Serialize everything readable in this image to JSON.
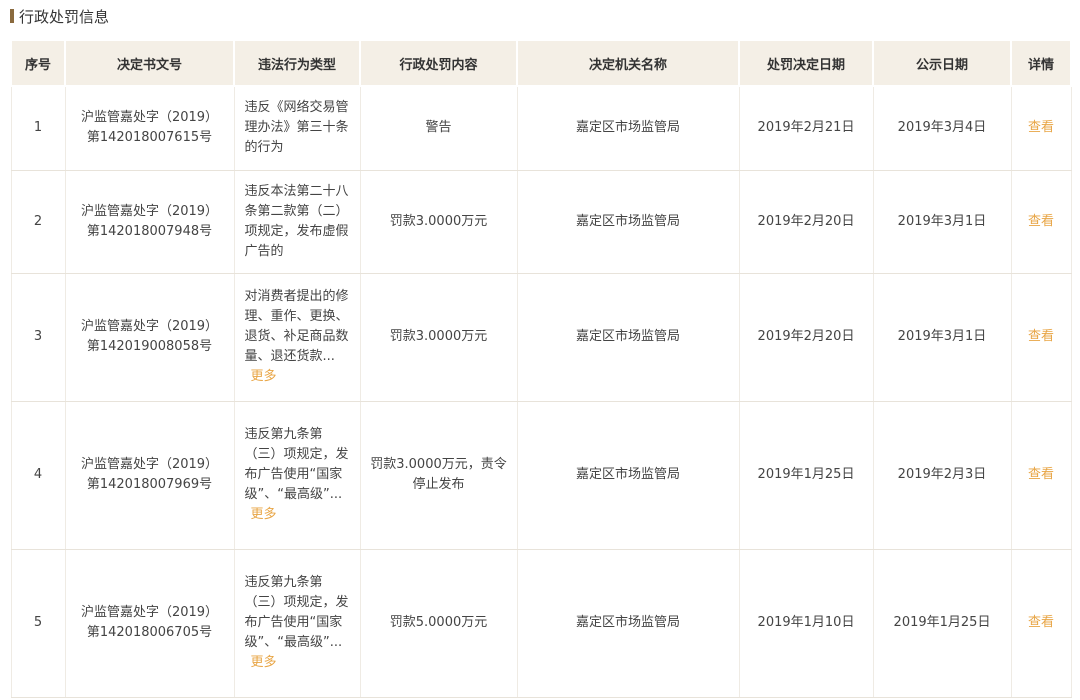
{
  "section": {
    "title": "行政处罚信息"
  },
  "table": {
    "headers": [
      "序号",
      "决定书文号",
      "违法行为类型",
      "行政处罚内容",
      "决定机关名称",
      "处罚决定日期",
      "公示日期",
      "详情"
    ],
    "rows": [
      {
        "index": "1",
        "doc_line1": "沪监管嘉处字（2019）",
        "doc_line2": "第142018007615号",
        "violation": "违反《网络交易管理办法》第三十条的行为",
        "more": "",
        "penalty": "警告",
        "authority": "嘉定区市场监管局",
        "decision_date": "2019年2月21日",
        "publish_date": "2019年3月4日",
        "detail": "查看"
      },
      {
        "index": "2",
        "doc_line1": "沪监管嘉处字（2019）",
        "doc_line2": "第142018007948号",
        "violation": "违反本法第二十八条第二款第（二）项规定，发布虚假广告的",
        "more": "",
        "penalty": "罚款3.0000万元",
        "authority": "嘉定区市场监管局",
        "decision_date": "2019年2月20日",
        "publish_date": "2019年3月1日",
        "detail": "查看"
      },
      {
        "index": "3",
        "doc_line1": "沪监管嘉处字（2019）",
        "doc_line2": "第142019008058号",
        "violation": "对消费者提出的修理、重作、更换、退货、补足商品数量、退还货款...",
        "more": "更多",
        "penalty": "罚款3.0000万元",
        "authority": "嘉定区市场监管局",
        "decision_date": "2019年2月20日",
        "publish_date": "2019年3月1日",
        "detail": "查看"
      },
      {
        "index": "4",
        "doc_line1": "沪监管嘉处字（2019）",
        "doc_line2": "第142018007969号",
        "violation": "违反第九条第（三）项规定，发布广告使用“国家级”、“最高级”...",
        "more": "更多",
        "penalty": "罚款3.0000万元，责令停止发布",
        "authority": "嘉定区市场监管局",
        "decision_date": "2019年1月25日",
        "publish_date": "2019年2月3日",
        "detail": "查看"
      },
      {
        "index": "5",
        "doc_line1": "沪监管嘉处字（2019）",
        "doc_line2": "第142018006705号",
        "violation": "违反第九条第（三）项规定，发布广告使用“国家级”、“最高级”...",
        "more": "更多",
        "penalty": "罚款5.0000万元",
        "authority": "嘉定区市场监管局",
        "decision_date": "2019年1月10日",
        "publish_date": "2019年1月25日",
        "detail": "查看"
      }
    ]
  },
  "colors": {
    "header_bg": "#f4efe6",
    "accent_bar": "#8a6a3e",
    "link": "#e8a545"
  }
}
